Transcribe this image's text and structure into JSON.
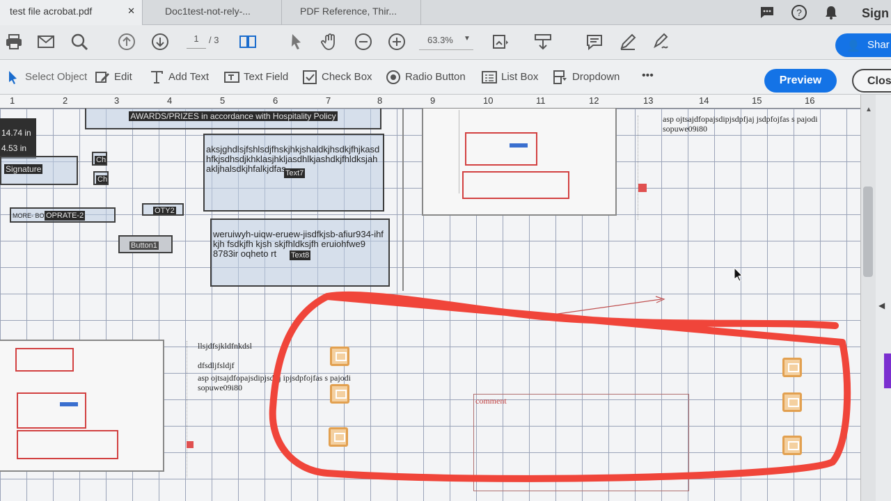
{
  "tabs": [
    {
      "label": "test file acrobat.pdf",
      "close": "✕"
    },
    {
      "label": "Doc1test-not-rely-..."
    },
    {
      "label": "PDF Reference, Thir..."
    }
  ],
  "header": {
    "sign_in": "Sign"
  },
  "toolbar": {
    "page_current": "1",
    "page_total": "/ 3",
    "zoom": "63.3%",
    "share": "Shar"
  },
  "form_tools": {
    "select": "Select Object",
    "edit": "Edit",
    "add_text": "Add Text",
    "text_field": "Text Field",
    "check_box": "Check Box",
    "radio": "Radio Button",
    "list_box": "List Box",
    "dropdown": "Dropdown",
    "more": "•••",
    "preview": "Preview",
    "close": "Clos"
  },
  "ruler": [
    "1",
    "2",
    "3",
    "4",
    "5",
    "6",
    "7",
    "8",
    "9",
    "10",
    "11",
    "12",
    "13",
    "14",
    "15",
    "16"
  ],
  "size_readout": {
    "width": "14.74 in",
    "height": "4.53 in"
  },
  "page": {
    "awards_field": "AWARDS/PRIZES in accordance with Hospitality Policy",
    "signature_tag": "Signature",
    "ch1": "Ch",
    "ch2": "Ch",
    "rbo_text": "MORE- BOTI",
    "rbo_tag": "OPRATE-2",
    "qty_tag": "OTY2",
    "button1": "Button1",
    "text7_body": "aksjghdlsjfshlsdjfhskjhkjshaldkjhsdkjfhjkasd hfkjsdhsdjkhklasjhkljasdhlkjashdkjfhldksjah akljhalsdkjhfalkjdfas",
    "text7_tag": "Text7",
    "text8_body": "weruiwyh-uiqw-eruew-jisdfkjsb-afiur934-ihf kjh fsdkjfh kjsh skjfhldksjfh eruiohfwe9 8783ir oqheto rt",
    "text8_tag": "Text8",
    "topright_line1": "asp ojtsajdfopajsdipjsdpfjaj jsdpfojfas s pajodi",
    "topright_line2": "sopuwe09i80",
    "lower_line1": "llsjdfsjkldfnkdsl",
    "lower_line2": "dfsdljfsldjf",
    "lower_line3": "asp ojtsajdfopajsdipjsdjij ipjsdpfojfas s pajodi",
    "lower_line4": "sopuwe09i80",
    "comment_label": "comment"
  },
  "colors": {
    "accent": "#1473e6",
    "annotation_red": "#f0453a",
    "note_orange": "#e2a050"
  }
}
